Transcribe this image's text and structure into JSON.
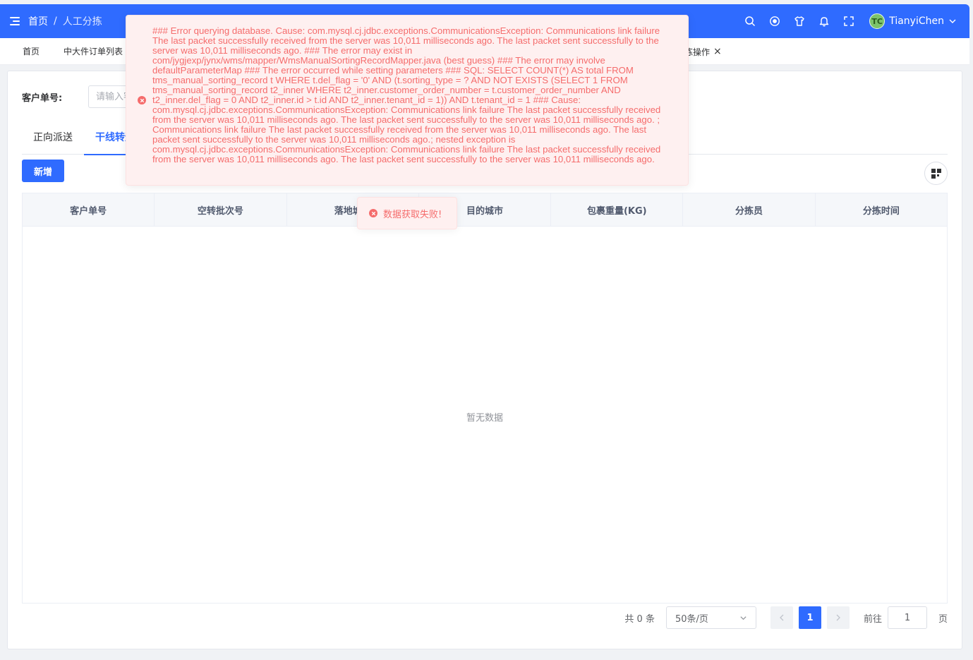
{
  "header": {
    "breadcrumb_home": "首页",
    "breadcrumb_sep": "/",
    "breadcrumb_current": "人工分拣",
    "username": "TianyiChen",
    "avatar_label": "TC",
    "icons": [
      "search-icon",
      "github-icon",
      "theme-shirt-icon",
      "bell-icon",
      "fullscreen-icon",
      "chevron-down-icon"
    ],
    "bg_color": "#2f6bff"
  },
  "tags": {
    "items": [
      "首页",
      "中大件订单列表"
    ],
    "active_label": "拣操作",
    "close_icon": "×"
  },
  "search": {
    "label": "客户单号:",
    "placeholder": "请输入客户单号"
  },
  "tabs": [
    "正向派送",
    "干线转运"
  ],
  "actions": {
    "add_label": "新增"
  },
  "table": {
    "columns": [
      "客户单号",
      "空转批次号",
      "落地城市",
      "目的城市",
      "包裹重量(KG)",
      "分拣员",
      "分拣时间"
    ],
    "empty_text": "暂无数据"
  },
  "pagination": {
    "total_text": "共 0 条",
    "page_size": "50条/页",
    "current_page": "1",
    "goto_label": "前往",
    "goto_value": "1",
    "page_suffix": "页"
  },
  "error_message": "### Error querying database. Cause: com.mysql.cj.jdbc.exceptions.CommunicationsException: Communications link failure The last packet successfully received from the server was 10,011 milliseconds ago. The last packet sent successfully to the server was 10,011 milliseconds ago. ### The error may exist in com/jygjexp/jynx/wms/mapper/WmsManualSortingRecordMapper.java (best guess) ### The error may involve defaultParameterMap ### The error occurred while setting parameters ### SQL: SELECT COUNT(*) AS total FROM tms_manual_sorting_record t WHERE t.del_flag = '0' AND (t.sorting_type = ? AND NOT EXISTS (SELECT 1 FROM tms_manual_sorting_record t2_inner WHERE t2_inner.customer_order_number = t.customer_order_number AND t2_inner.del_flag = 0 AND t2_inner.id > t.id AND t2_inner.tenant_id = 1)) AND t.tenant_id = 1 ### Cause: com.mysql.cj.jdbc.exceptions.CommunicationsException: Communications link failure The last packet successfully received from the server was 10,011 milliseconds ago. The last packet sent successfully to the server was 10,011 milliseconds ago. ; Communications link failure The last packet successfully received from the server was 10,011 milliseconds ago. The last packet sent successfully to the server was 10,011 milliseconds ago.; nested exception is com.mysql.cj.jdbc.exceptions.CommunicationsException: Communications link failure The last packet successfully received from the server was 10,011 milliseconds ago. The last packet sent successfully to the server was 10,011 milliseconds ago.",
  "toast": {
    "text": "数据获取失败!"
  },
  "colors": {
    "primary": "#2f6bff",
    "error": "#f56c6c",
    "error_bg": "#fef0f0"
  }
}
